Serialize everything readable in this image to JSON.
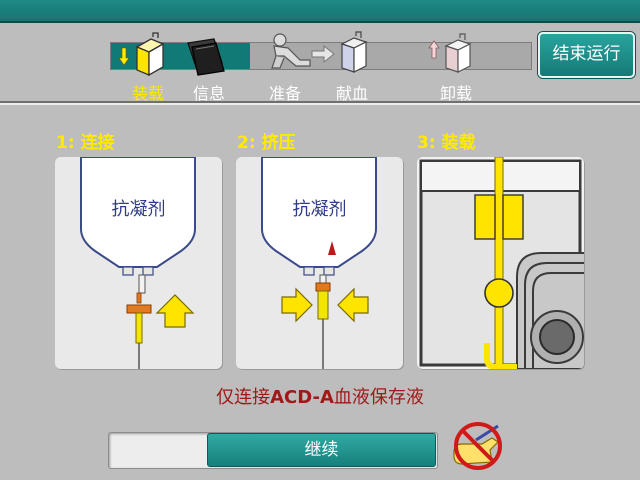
{
  "steps": [
    {
      "label": "装载",
      "icon": "load-icon",
      "active": true
    },
    {
      "label": "信息",
      "icon": "info-folder-icon",
      "active": false
    },
    {
      "label": "准备",
      "icon": "prepare-donor-icon",
      "active": false
    },
    {
      "label": "献血",
      "icon": "donate-icon",
      "active": false
    },
    {
      "label": "卸载",
      "icon": "unload-icon",
      "active": false
    }
  ],
  "progress_percent": 33,
  "end_run_label": "结束运行",
  "panels": [
    {
      "title_num": "1:",
      "title_text": "连接",
      "bag_label": "抗凝剂"
    },
    {
      "title_num": "2:",
      "title_text": "挤压",
      "bag_label": "抗凝剂"
    },
    {
      "title_num": "3:",
      "title_text": "装载"
    }
  ],
  "notice": {
    "prefix": "仅连接",
    "bold": "ACD-A",
    "suffix": "血液保存液"
  },
  "continue_label": "继续",
  "colors": {
    "teal": "#167470",
    "yellow": "#ffea00",
    "notice_red": "#a01818",
    "bag_text": "#2f3a88"
  }
}
